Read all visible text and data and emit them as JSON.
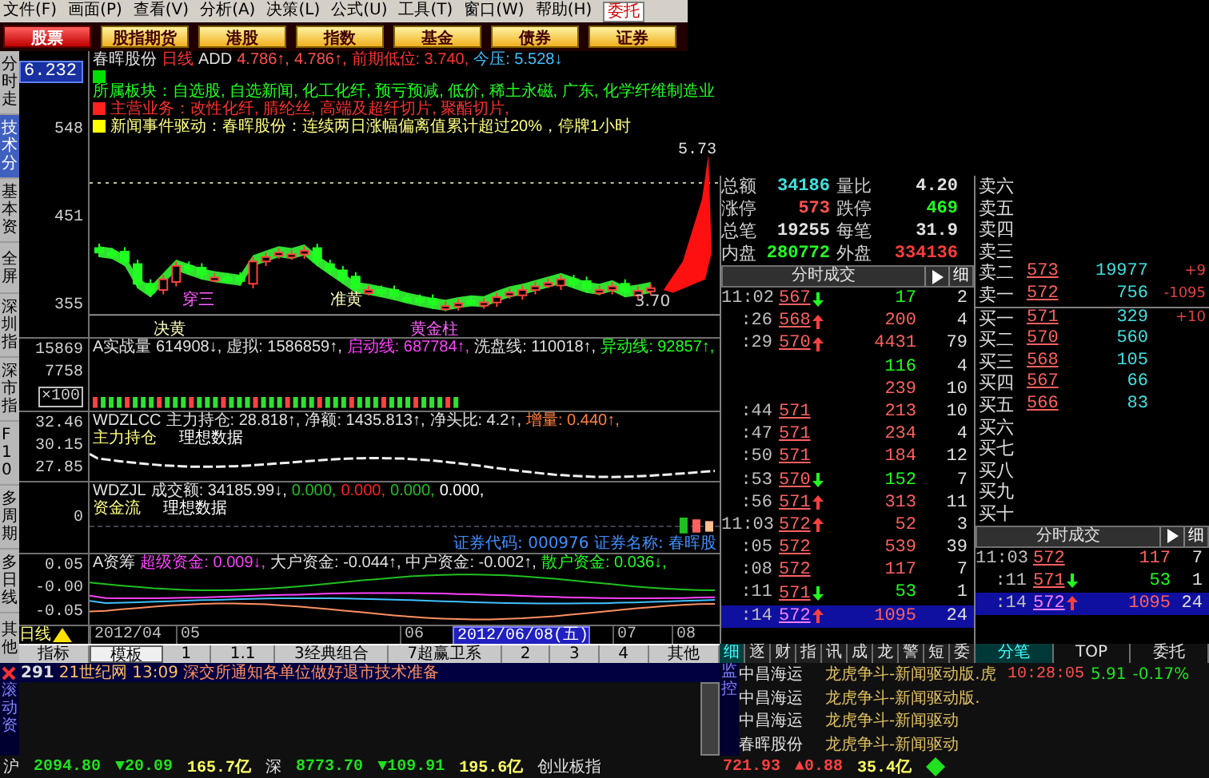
{
  "menu": {
    "items": [
      "文件(F)",
      "画面(P)",
      "查看(V)",
      "分析(A)",
      "决策(L)",
      "公式(U)",
      "工具(T)",
      "窗口(W)",
      "帮助(H)"
    ],
    "trade_button": "委托"
  },
  "toolbar": [
    {
      "label": "股票",
      "selected": true
    },
    {
      "label": "股指期货",
      "selected": false
    },
    {
      "label": "港股",
      "selected": false
    },
    {
      "label": "指数",
      "selected": false
    },
    {
      "label": "基金",
      "selected": false
    },
    {
      "label": "债券",
      "selected": false
    },
    {
      "label": "证券",
      "selected": false
    }
  ],
  "side_tabs": [
    {
      "label": "分时走",
      "selected": false
    },
    {
      "label": "技术分",
      "selected": true
    },
    {
      "label": "基本资",
      "selected": false
    },
    {
      "label": "全屏",
      "selected": false
    },
    {
      "label": "深圳指",
      "selected": false
    },
    {
      "label": "深市指",
      "selected": false
    },
    {
      "label": "F10",
      "selected": false
    },
    {
      "label": "多周期",
      "selected": false
    },
    {
      "label": "多日线",
      "selected": false
    },
    {
      "label": "其他",
      "selected": false
    }
  ],
  "main_chart": {
    "current_price": "6.232",
    "axis_labels": [
      "548",
      "451",
      "355"
    ],
    "right_label": "5.73",
    "info_lines": [
      {
        "parts": [
          {
            "text": "春晖股份",
            "color": "#e0e0e0"
          },
          {
            "text": "日线",
            "color": "#ff3030"
          },
          {
            "text": "ADD",
            "color": "#e0e0e0"
          },
          {
            "text": "4.786↑,",
            "color": "#ff5050"
          },
          {
            "text": "4.786↑,",
            "color": "#ff5050"
          },
          {
            "text": "前期低位: 3.740,",
            "color": "#ff3030"
          },
          {
            "text": "今压: 5.528↓",
            "color": "#40c0ff"
          }
        ]
      },
      {
        "color": "#00e000",
        "parts": [
          {
            "text": "所属板块：自选股, 自选新闻, 化工化纤, 预亏预减, 低价, 稀土永磁, 广东, 化学纤维制造业",
            "color": "#20ff20"
          }
        ]
      },
      {
        "color": "#ff2020",
        "parts": [
          {
            "text": "主营业务：改性化纤, 腈纶丝, 高端及超纤切片, 聚酯切片,",
            "color": "#ff3030"
          }
        ]
      },
      {
        "color": "#ffff00",
        "parts": [
          {
            "text": "新闻事件驱动：春晖股份：连续两日涨幅偏离值累计超过20%，停牌1小时",
            "color": "#ffff80"
          }
        ]
      }
    ],
    "marks": [
      "决黄",
      "穿三",
      "准黄",
      "黄金柱",
      "3.70"
    ]
  },
  "panes": [
    {
      "kind": "volume",
      "axis_labels": [
        "15869",
        "7758"
      ],
      "unit": "×100",
      "info": [
        {
          "text": "A实战量 614908↓,",
          "color": "#e0e0e0"
        },
        {
          "text": "虚拟: 1586859↑,",
          "color": "#e0e0e0"
        },
        {
          "text": "启动线: 687784↑,",
          "color": "#ff40ff"
        },
        {
          "text": "洗盘线: 110018↑,",
          "color": "#e0e0e0"
        },
        {
          "text": "异动线: 92857↑,",
          "color": "#20ff20"
        }
      ]
    },
    {
      "kind": "line",
      "axis_labels": [
        "32.46",
        "30.15",
        "27.85"
      ],
      "info": [
        {
          "text": "WDZLCC",
          "color": "#e0e0e0"
        },
        {
          "text": "主力持仓: 28.818↑,",
          "color": "#e0e0e0"
        },
        {
          "text": "净额: 1435.813↑,",
          "color": "#e0e0e0"
        },
        {
          "text": "净头比: 4.2↑,",
          "color": "#e0e0e0"
        },
        {
          "text": "增量: 0.440↑,",
          "color": "#ff8040"
        }
      ],
      "notes": [
        {
          "text": "主力持仓",
          "color": "#ffff80"
        },
        {
          "text": "理想数据",
          "color": "#ffffff"
        }
      ]
    },
    {
      "kind": "bars",
      "axis_labels": [
        "0"
      ],
      "info": [
        {
          "text": "WDZJL",
          "color": "#e0e0e0"
        },
        {
          "text": "成交额: 34185.99↓,",
          "color": "#e0e0e0"
        },
        {
          "text": "0.000,",
          "color": "#20c020"
        },
        {
          "text": "0.000,",
          "color": "#ff2020"
        },
        {
          "text": "0.000,",
          "color": "#20c020"
        },
        {
          "text": "0.000,",
          "color": "#ffffff"
        }
      ],
      "notes": [
        {
          "text": "资金流",
          "color": "#ffff80"
        },
        {
          "text": "理想数据",
          "color": "#ffffff"
        }
      ],
      "footer": "证券代码: 000976 证券名称: 春晖股"
    },
    {
      "kind": "multiline",
      "axis_labels": [
        "0.05",
        "-0.00",
        "-0.05"
      ],
      "info": [
        {
          "text": "A资筹",
          "color": "#e0e0e0"
        },
        {
          "text": "超级资金: 0.009↓,",
          "color": "#ff40ff"
        },
        {
          "text": "大户资金: -0.044↑,",
          "color": "#e0e0e0"
        },
        {
          "text": "中户资金: -0.002↑,",
          "color": "#e0e0e0"
        },
        {
          "text": "散户资金: 0.036↓,",
          "color": "#20ff20"
        }
      ]
    }
  ],
  "date_axis": {
    "period": "日线",
    "labels": [
      {
        "text": "2012/04",
        "selected": false
      },
      {
        "text": "05",
        "selected": false
      },
      {
        "text": "06",
        "selected": false
      },
      {
        "text": "2012/06/08(五)",
        "selected": true
      },
      {
        "text": "07",
        "selected": false
      },
      {
        "text": "08",
        "selected": false
      }
    ]
  },
  "template_tabs": [
    {
      "label": "指标",
      "selected": false
    },
    {
      "label": "模板",
      "selected": true
    },
    {
      "label": "1",
      "selected": false
    },
    {
      "label": "1.1",
      "selected": false
    },
    {
      "label": "3经典组合",
      "selected": false
    },
    {
      "label": "7超赢卫系",
      "selected": false
    },
    {
      "label": "2",
      "selected": false
    },
    {
      "label": "3",
      "selected": false
    },
    {
      "label": "4",
      "selected": false
    },
    {
      "label": "其他",
      "selected": false
    }
  ],
  "quote": [
    [
      {
        "label": "总额",
        "value": "34186",
        "color": "#40e0e0"
      },
      {
        "label": "量比",
        "value": "4.20",
        "color": "#e0e0e0"
      }
    ],
    [
      {
        "label": "涨停",
        "value": "573",
        "color": "#ff5050"
      },
      {
        "label": "跌停",
        "value": "469",
        "color": "#20ff20"
      }
    ],
    [
      {
        "label": "总笔",
        "value": "19255",
        "color": "#e0e0e0"
      },
      {
        "label": "每笔",
        "value": "31.9",
        "color": "#e0e0e0"
      }
    ],
    [
      {
        "label": "内盘",
        "value": "280772",
        "color": "#20ff20"
      },
      {
        "label": "外盘",
        "value": "334136",
        "color": "#ff3c3c"
      }
    ]
  ],
  "ticks": {
    "title": "分时成交",
    "detail_button": "细",
    "rows": [
      {
        "time": "11:02",
        "price": "567",
        "up": false,
        "down": true,
        "volume": "17",
        "sell": true,
        "count": "2",
        "selected": false
      },
      {
        "time": ":26",
        "price": "568",
        "up": true,
        "down": false,
        "volume": "200",
        "sell": false,
        "count": "4",
        "selected": false
      },
      {
        "time": ":29",
        "price": "570",
        "up": true,
        "down": false,
        "volume": "4431",
        "sell": false,
        "count": "79",
        "selected": false
      },
      {
        "up": false,
        "down": false,
        "volume": "116",
        "sell": true,
        "count": "4",
        "selected": false
      },
      {
        "up": false,
        "down": false,
        "volume": "239",
        "sell": false,
        "count": "10",
        "selected": false
      },
      {
        "time": ":44",
        "price": "571",
        "up": false,
        "down": false,
        "volume": "213",
        "sell": false,
        "count": "10",
        "selected": false
      },
      {
        "time": ":47",
        "price": "571",
        "up": false,
        "down": false,
        "volume": "234",
        "sell": false,
        "count": "4",
        "selected": false
      },
      {
        "time": ":50",
        "price": "571",
        "up": false,
        "down": false,
        "volume": "184",
        "sell": false,
        "count": "12",
        "selected": false
      },
      {
        "time": ":53",
        "price": "570",
        "up": false,
        "down": true,
        "volume": "152",
        "sell": true,
        "count": "7",
        "selected": false
      },
      {
        "time": ":56",
        "price": "571",
        "up": true,
        "down": false,
        "volume": "313",
        "sell": false,
        "count": "11",
        "selected": false
      },
      {
        "time": "11:03",
        "price": "572",
        "up": true,
        "down": false,
        "volume": "52",
        "sell": false,
        "count": "3",
        "selected": false
      },
      {
        "time": ":05",
        "price": "572",
        "up": false,
        "down": false,
        "volume": "539",
        "sell": false,
        "count": "39",
        "selected": false
      },
      {
        "time": ":08",
        "price": "572",
        "up": false,
        "down": false,
        "volume": "117",
        "sell": false,
        "count": "7",
        "selected": false
      },
      {
        "time": ":11",
        "price": "571",
        "up": false,
        "down": true,
        "volume": "53",
        "sell": true,
        "count": "1",
        "selected": false
      },
      {
        "time": ":14",
        "price": "572",
        "up": true,
        "down": false,
        "volume": "1095",
        "sell": false,
        "count": "24",
        "selected": true
      }
    ]
  },
  "order_book": {
    "asks": [
      {
        "label": "卖六"
      },
      {
        "label": "卖五"
      },
      {
        "label": "卖四"
      },
      {
        "label": "卖三"
      },
      {
        "label": "卖二",
        "price": "573",
        "volume": "19977",
        "change": "+9"
      },
      {
        "label": "卖一",
        "price": "572",
        "volume": "756",
        "change": "-1095"
      }
    ],
    "bids": [
      {
        "label": "买一",
        "price": "571",
        "volume": "329",
        "change": "+10"
      },
      {
        "label": "买二",
        "price": "570",
        "volume": "560"
      },
      {
        "label": "买三",
        "price": "568",
        "volume": "105"
      },
      {
        "label": "买四",
        "price": "567",
        "volume": "66"
      },
      {
        "label": "买五",
        "price": "566",
        "volume": "83"
      },
      {
        "label": "买六"
      },
      {
        "label": "买七"
      },
      {
        "label": "买八"
      },
      {
        "label": "买九"
      },
      {
        "label": "买十"
      }
    ]
  },
  "mini_ticks": {
    "title": "分时成交",
    "detail_button": "细",
    "rows": [
      {
        "time": "11:03",
        "price": "572",
        "up": false,
        "down": false,
        "volume": "117",
        "sell": false,
        "count": "7",
        "selected": false
      },
      {
        "time": ":11",
        "price": "571",
        "up": false,
        "down": true,
        "volume": "53",
        "sell": true,
        "count": "1",
        "selected": false
      },
      {
        "time": ":14",
        "price": "572",
        "up": true,
        "down": false,
        "volume": "1095",
        "sell": false,
        "count": "24",
        "selected": true
      }
    ]
  },
  "detail_tabs": [
    {
      "label": "细",
      "selected": true
    },
    {
      "label": "逐",
      "selected": false
    },
    {
      "label": "财",
      "selected": false
    },
    {
      "label": "指",
      "selected": false
    },
    {
      "label": "讯",
      "selected": false
    },
    {
      "label": "成",
      "selected": false
    },
    {
      "label": "龙",
      "selected": false
    },
    {
      "label": "警",
      "selected": false
    },
    {
      "label": "短",
      "selected": false
    },
    {
      "label": "委",
      "selected": false
    }
  ],
  "book_tabs": [
    {
      "label": "分笔",
      "selected": true
    },
    {
      "label": "TOP",
      "selected": false
    },
    {
      "label": "委托",
      "selected": false
    }
  ],
  "news": {
    "count": "291",
    "source": "21世纪网",
    "time": "13:09",
    "headline": "深交所通知各单位做好退市技术准备",
    "side_label": "滚动资",
    "monitor_label": "监控"
  },
  "news_list": [
    {
      "stock": "中昌海运",
      "title": "龙虎争斗-新闻驱动版.虎",
      "time": "10:28:05",
      "price": "5.91",
      "change": "-0.17%"
    },
    {
      "stock": "中昌海运",
      "title": "龙虎争斗-新闻驱动版."
    },
    {
      "stock": "中昌海运",
      "title": "龙虎争斗-新闻驱动"
    },
    {
      "stock": "春晖股份",
      "title": "龙虎争斗-新闻驱动"
    }
  ],
  "status_left": [
    {
      "text": "沪",
      "kind": "label"
    },
    {
      "text": "2094.80",
      "kind": "down"
    },
    {
      "text": "▼20.09",
      "kind": "down"
    },
    {
      "text": "165.7亿",
      "kind": "amount"
    },
    {
      "text": "深",
      "kind": "label"
    },
    {
      "text": "8773.70",
      "kind": "down"
    },
    {
      "text": "▼109.91",
      "kind": "down"
    },
    {
      "text": "195.6亿",
      "kind": "amount"
    },
    {
      "text": "创业板指",
      "kind": "label"
    }
  ],
  "status_right": [
    {
      "text": "721.93",
      "kind": "up"
    },
    {
      "text": "▲0.88",
      "kind": "up"
    },
    {
      "text": "35.4亿",
      "kind": "amount"
    }
  ]
}
